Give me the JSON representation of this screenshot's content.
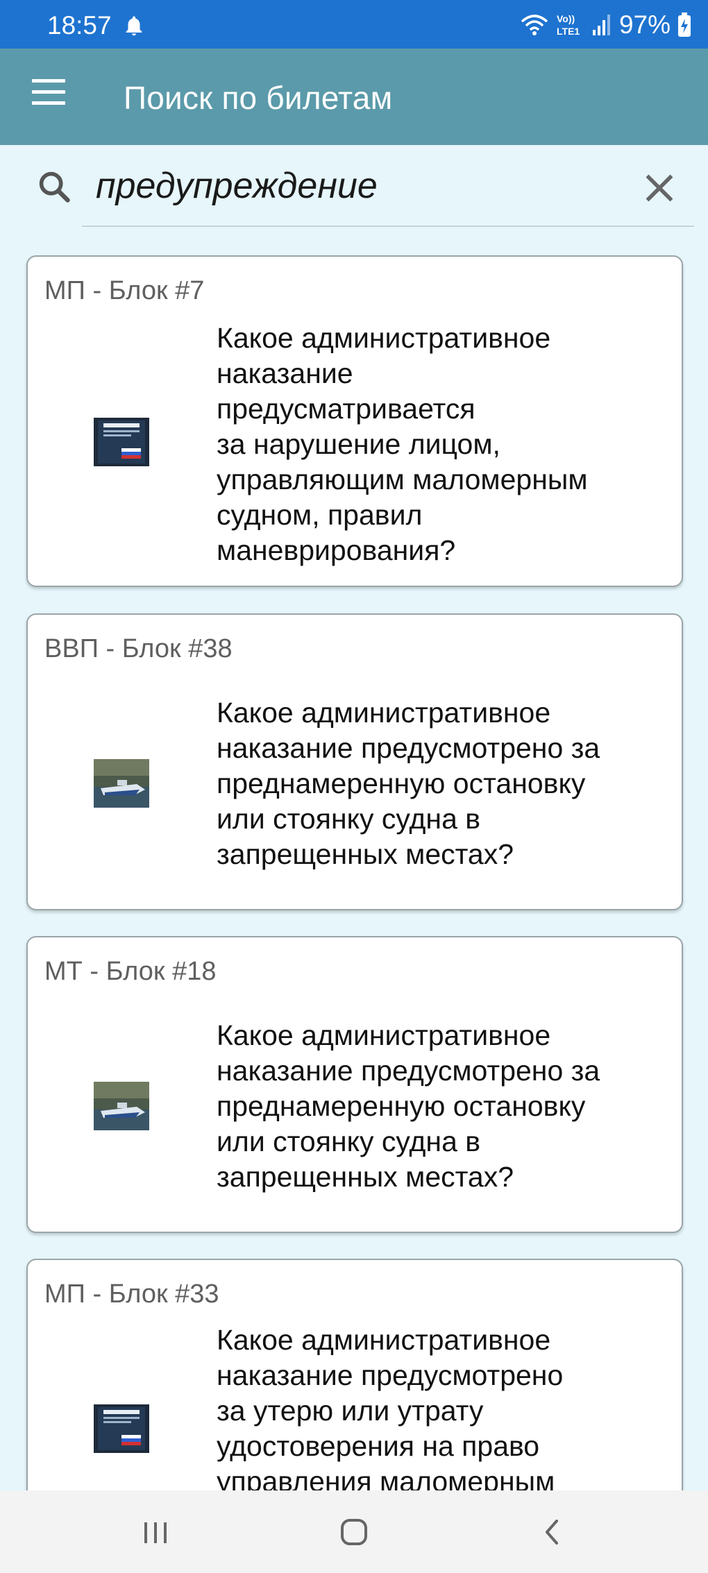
{
  "status": {
    "time": "18:57",
    "battery": "97%",
    "network_label": "Vo)) LTE1"
  },
  "appbar": {
    "title": "Поиск по билетам",
    "menu_icon": "hamburger-menu-icon"
  },
  "search": {
    "value": "предупреждение",
    "search_icon": "magnifier-icon",
    "clear_icon": "close-icon"
  },
  "results": [
    {
      "header": "МП - Блок #7",
      "image": "code-book-cover",
      "lines": [
        "Какое административное",
        "наказание",
        "предусматривается",
        "за нарушение лицом,",
        "управляющим маломерным",
        "судном, правил",
        "маневрирования?"
      ]
    },
    {
      "header": "ВВП - Блок #38",
      "image": "motorboat-photo",
      "lines": [
        "Какое административное",
        "наказание предусмотрено за",
        "преднамеренную остановку",
        "или стоянку судна в",
        "запрещенных местах?"
      ]
    },
    {
      "header": "МТ - Блок #18",
      "image": "motorboat-photo",
      "lines": [
        "Какое административное",
        "наказание предусмотрено за",
        "преднамеренную остановку",
        "или стоянку судна в",
        "запрещенных местах?"
      ]
    },
    {
      "header": "МП - Блок #33",
      "image": "code-book-cover",
      "lines": [
        "Какое административное",
        "наказание предусмотрено",
        "за утерю или утрату",
        "удостоверения на право",
        "управления маломерным"
      ]
    }
  ],
  "navbar": {
    "recents_icon": "recent-apps-icon",
    "home_icon": "home-icon",
    "back_icon": "back-icon"
  },
  "colors": {
    "status_bar": "#1e73d0",
    "app_bar": "#5b9aaa",
    "background": "#e6f6fb"
  }
}
